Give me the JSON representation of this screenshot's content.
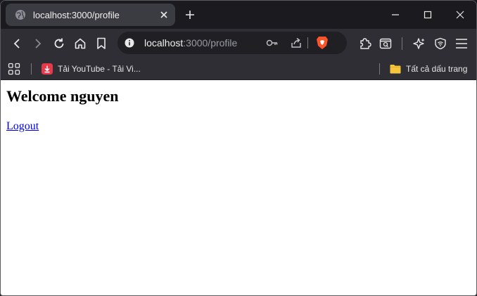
{
  "browser": {
    "tab": {
      "title": "localhost:3000/profile"
    },
    "url": {
      "host": "localhost",
      "path": ":3000/profile"
    },
    "bookmarks": [
      {
        "label": "Tải YouTube - Tải Vi..."
      },
      {
        "label": "Tất cả dấu trang"
      }
    ]
  },
  "page": {
    "heading": "Welcome nguyen",
    "logout_label": "Logout"
  },
  "colors": {
    "brave_accent": "#fb542b",
    "bookmark_youtube": "#e8394a",
    "folder": "#f5c53d",
    "link": "#0000ee"
  }
}
